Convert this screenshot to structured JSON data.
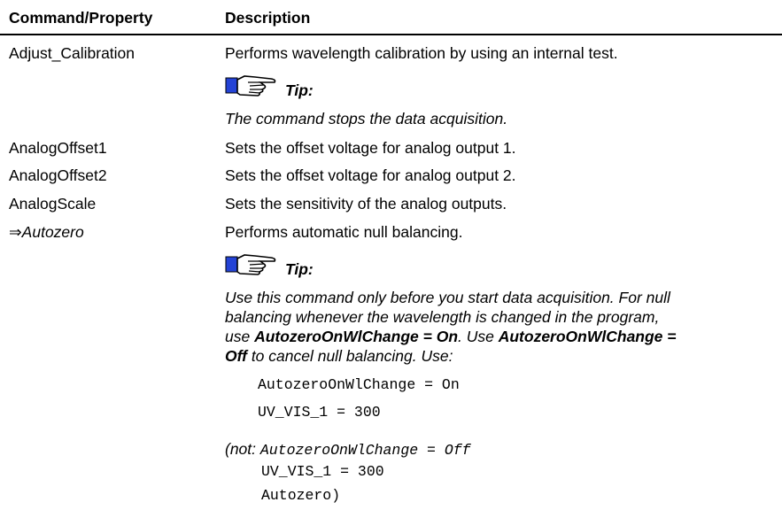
{
  "header": {
    "col1": "Command/Property",
    "col2": "Description"
  },
  "rows": {
    "adjust": {
      "name": "Adjust_Calibration",
      "desc": "Performs wavelength calibration by using an internal test.",
      "tip_label": "Tip:",
      "tip_text": "The command stops the data acquisition."
    },
    "offset1": {
      "name": "AnalogOffset1",
      "desc": "Sets the offset voltage for analog output 1."
    },
    "offset2": {
      "name": "AnalogOffset2",
      "desc": "Sets the offset voltage for analog output 2."
    },
    "scale": {
      "name": "AnalogScale",
      "desc": "Sets the sensitivity of the analog outputs."
    },
    "autozero": {
      "arrow": "⇒",
      "name": "Autozero",
      "desc": "Performs automatic null balancing.",
      "tip_label": "Tip:",
      "p1": "Use this command only before you start data acquisition. For null",
      "p2": "balancing whenever the wavelength is changed in the program,",
      "p3a": "use ",
      "p3b": "AutozeroOnWlChange = On",
      "p3c": ". Use ",
      "p3d": "AutozeroOnWlChange =",
      "p4a": "Off",
      "p4b": " to cancel null balancing. Use:",
      "code1": "AutozeroOnWlChange = On",
      "code2": "UV_VIS_1 = 300",
      "not_label": "(not:",
      "code3": "AutozeroOnWlChange = Off",
      "code4": "UV_VIS_1 = 300",
      "code5": "Autozero)"
    }
  },
  "icons": {
    "tip": "pointing-hand-icon"
  }
}
